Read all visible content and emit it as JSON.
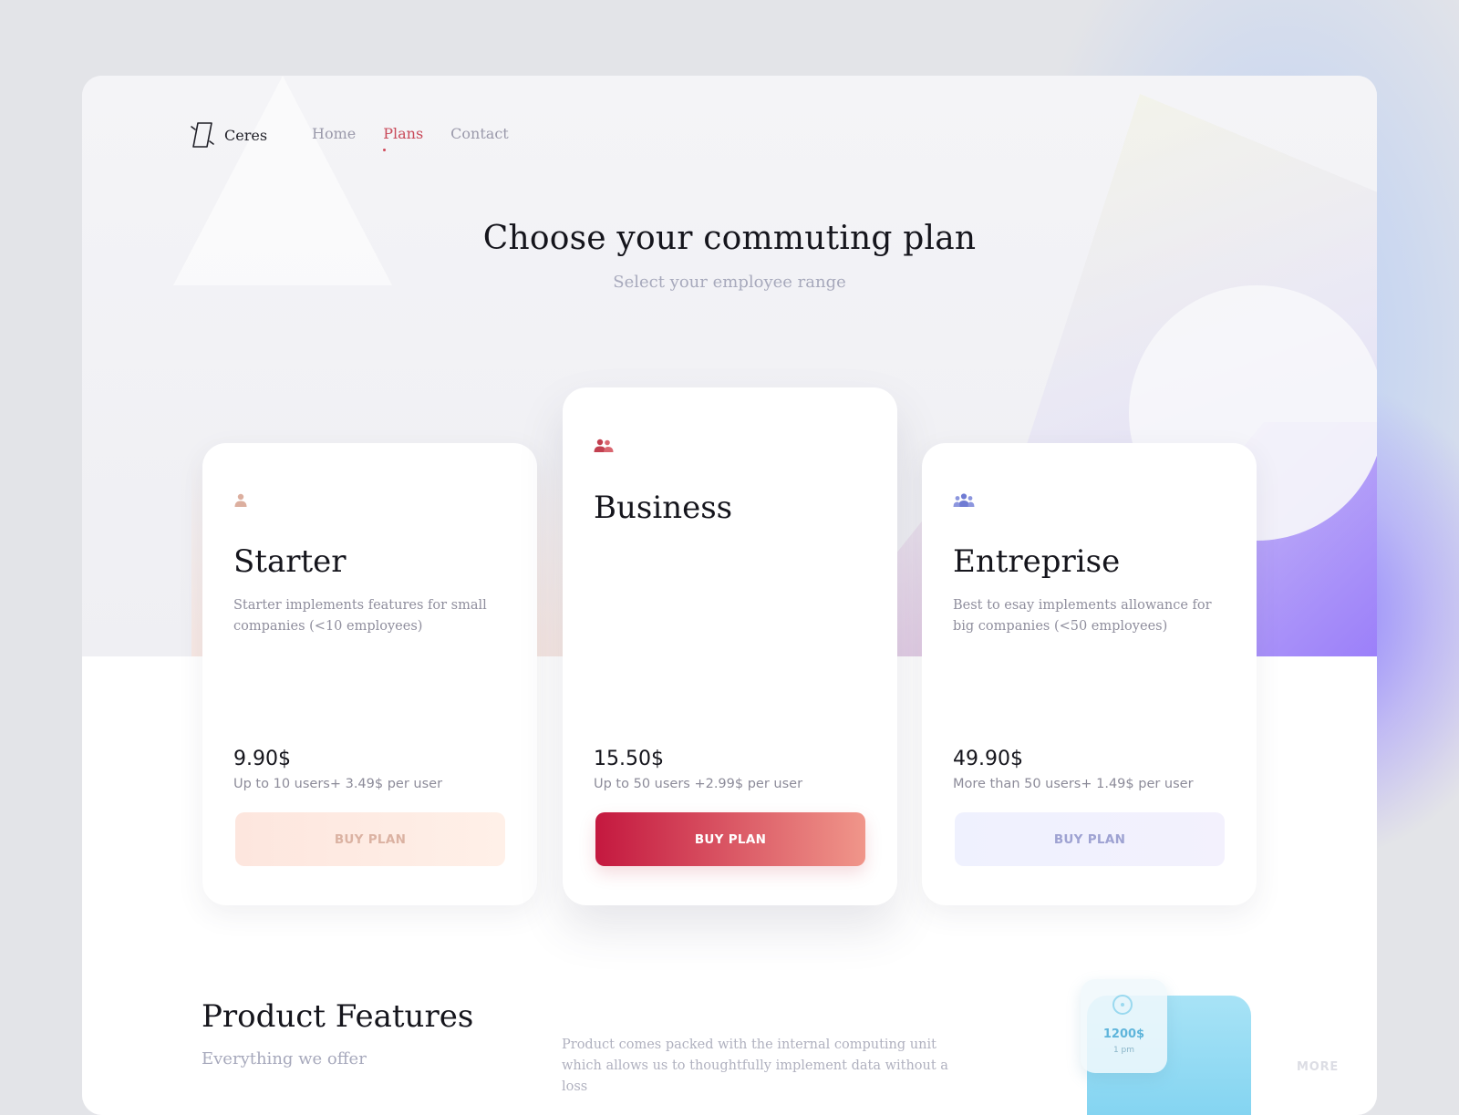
{
  "brand": {
    "name": "Ceres",
    "logo_icon": "ceres-logo-icon"
  },
  "nav": {
    "items": [
      {
        "label": "Home",
        "active": false
      },
      {
        "label": "Plans",
        "active": true
      },
      {
        "label": "Contact",
        "active": false
      }
    ]
  },
  "hero": {
    "title": "Choose your commuting plan",
    "subtitle": "Select your employee range"
  },
  "plans": [
    {
      "icon": "single-user-icon",
      "name": "Starter",
      "description": "Starter implements features for small companies (<10 employees)",
      "price": "9.90$",
      "note": "Up to 10 users+ 3.49$ per user",
      "button": "BUY PLAN",
      "accent": "#dbb2a2"
    },
    {
      "icon": "two-users-icon",
      "name": "Business",
      "description": "",
      "price": "15.50$",
      "note": "Up to 50 users +2.99$ per user",
      "button": "BUY PLAN",
      "accent": "#c4183f"
    },
    {
      "icon": "group-users-icon",
      "name": "Entreprise",
      "description": "Best to esay implements allowance for big companies (<50 employees)",
      "price": "49.90$",
      "note": "More than 50 users+ 1.49$ per user",
      "button": "BUY PLAN",
      "accent": "#8c93d6"
    }
  ],
  "features": {
    "title": "Product Features",
    "subtitle": "Everything we offer",
    "description": "Product comes packed with the internal computing unit which allows us to thoughtfully implement data without a loss",
    "widget": {
      "value": "1200$",
      "time": "1 pm"
    },
    "more": "MORE"
  },
  "colors": {
    "accent_red": "#c94a5a",
    "muted_text": "#9b9aab",
    "title_text": "#15151c"
  }
}
